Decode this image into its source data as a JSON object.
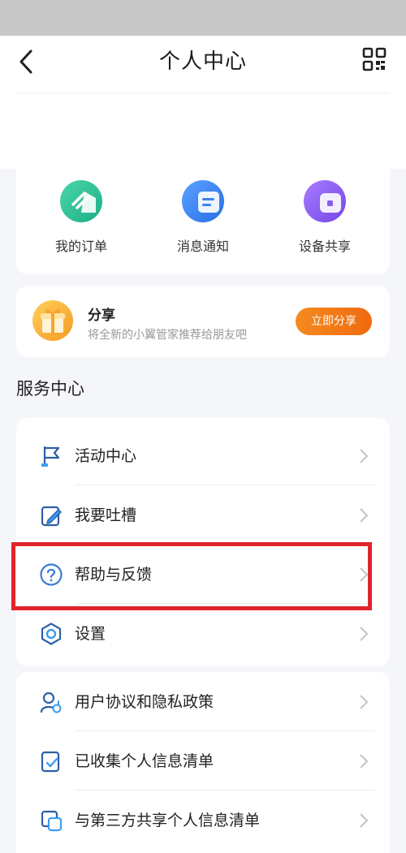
{
  "header": {
    "title": "个人中心",
    "back_icon": "back-arrow-icon",
    "qr_icon": "qr-code-icon"
  },
  "quick_actions": [
    {
      "label": "我的订单",
      "icon": "order-icon",
      "color": "#2cc39a"
    },
    {
      "label": "消息通知",
      "icon": "message-icon",
      "color": "#3a82f0"
    },
    {
      "label": "设备共享",
      "icon": "device-share-icon",
      "color": "#8a5cf0"
    }
  ],
  "share": {
    "title": "分享",
    "subtitle": "将全新的小翼管家推荐给朋友吧",
    "button": "立即分享",
    "icon": "gift-icon",
    "button_color": "#f27514"
  },
  "service": {
    "title": "服务中心",
    "items": [
      {
        "label": "活动中心",
        "icon": "flag-icon"
      },
      {
        "label": "我要吐槽",
        "icon": "edit-note-icon"
      },
      {
        "label": "帮助与反馈",
        "icon": "help-circle-icon"
      },
      {
        "label": "设置",
        "icon": "settings-icon"
      }
    ]
  },
  "policy": {
    "items": [
      {
        "label": "用户协议和隐私政策",
        "icon": "user-privacy-icon"
      },
      {
        "label": "已收集个人信息清单",
        "icon": "checklist-icon"
      },
      {
        "label": "与第三方共享个人信息清单",
        "icon": "third-party-share-icon"
      }
    ]
  },
  "highlight_color": "#e0252b"
}
